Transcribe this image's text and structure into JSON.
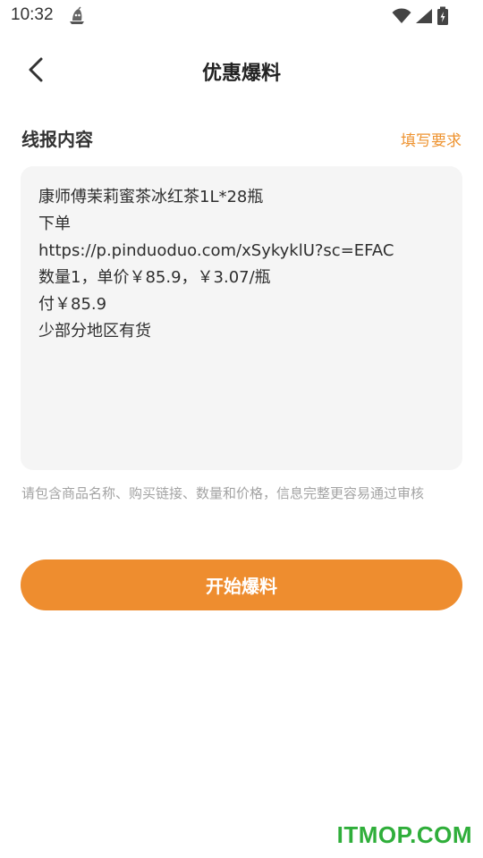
{
  "status_bar": {
    "time": "10:32",
    "app_icon": "ghost-ship-icon",
    "icons": [
      "wifi-icon",
      "signal-icon",
      "battery-charging-icon"
    ]
  },
  "nav": {
    "back_icon": "chevron-left-icon",
    "title": "优惠爆料"
  },
  "section": {
    "title": "线报内容",
    "requirements_link": "填写要求"
  },
  "content": {
    "lines": [
      "康师傅茉莉蜜茶冰红茶1L*28瓶",
      "下单",
      "https://p.pinduoduo.com/xSykyklU?sc=EFAC",
      "数量1，单价￥85.9，￥3.07/瓶",
      "付￥85.9",
      "少部分地区有货"
    ]
  },
  "hint": "请包含商品名称、购买链接、数量和价格，信息完整更容易通过审核",
  "submit_label": "开始爆料",
  "watermark": "ITMOP.COM",
  "colors": {
    "accent": "#ee8d2f",
    "link": "#ee9330",
    "box_bg": "#f5f5f5",
    "hint": "#a3a3a3",
    "watermark": "#2fae3a"
  }
}
